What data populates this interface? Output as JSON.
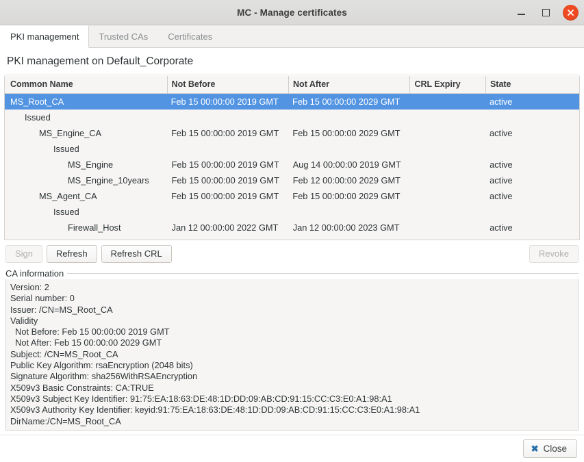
{
  "window": {
    "title": "MC - Manage certificates",
    "controls": {
      "minimize": "minimize-icon",
      "maximize": "maximize-icon",
      "close": "close-icon"
    }
  },
  "tabs": [
    {
      "label": "PKI management",
      "active": true
    },
    {
      "label": "Trusted CAs",
      "active": false
    },
    {
      "label": "Certificates",
      "active": false
    }
  ],
  "page": {
    "heading": "PKI management on Default_Corporate"
  },
  "tree": {
    "columns": [
      {
        "key": "name",
        "label": "Common Name"
      },
      {
        "key": "nb",
        "label": "Not Before"
      },
      {
        "key": "na",
        "label": "Not After"
      },
      {
        "key": "crl",
        "label": "CRL Expiry"
      },
      {
        "key": "state",
        "label": "State"
      }
    ],
    "rows": [
      {
        "indent": 1,
        "name": "MS_Root_CA",
        "nb": "Feb 15 00:00:00 2019 GMT",
        "na": "Feb 15 00:00:00 2029 GMT",
        "crl": "",
        "state": "active",
        "selected": true
      },
      {
        "indent": 2,
        "name": "Issued",
        "nb": "",
        "na": "",
        "crl": "",
        "state": "",
        "selected": false
      },
      {
        "indent": 3,
        "name": "MS_Engine_CA",
        "nb": "Feb 15 00:00:00 2019 GMT",
        "na": "Feb 15 00:00:00 2029 GMT",
        "crl": "",
        "state": "active",
        "selected": false
      },
      {
        "indent": 4,
        "name": "Issued",
        "nb": "",
        "na": "",
        "crl": "",
        "state": "",
        "selected": false
      },
      {
        "indent": 5,
        "name": "MS_Engine",
        "nb": "Feb 15 00:00:00 2019 GMT",
        "na": "Aug 14 00:00:00 2019 GMT",
        "crl": "",
        "state": "active",
        "selected": false
      },
      {
        "indent": 5,
        "name": "MS_Engine_10years",
        "nb": "Feb 15 00:00:00 2019 GMT",
        "na": "Feb 12 00:00:00 2029 GMT",
        "crl": "",
        "state": "active",
        "selected": false
      },
      {
        "indent": 3,
        "name": "MS_Agent_CA",
        "nb": "Feb 15 00:00:00 2019 GMT",
        "na": "Feb 15 00:00:00 2029 GMT",
        "crl": "",
        "state": "active",
        "selected": false
      },
      {
        "indent": 4,
        "name": "Issued",
        "nb": "",
        "na": "",
        "crl": "",
        "state": "",
        "selected": false
      },
      {
        "indent": 5,
        "name": "Firewall_Host",
        "nb": "Jan 12 00:00:00 2022 GMT",
        "na": "Jan 12 00:00:00 2023 GMT",
        "crl": "",
        "state": "active",
        "selected": false
      }
    ]
  },
  "actions": {
    "sign": {
      "label": "Sign",
      "enabled": false
    },
    "refresh": {
      "label": "Refresh",
      "enabled": true
    },
    "refresh_crl": {
      "label": "Refresh CRL",
      "enabled": true
    },
    "revoke": {
      "label": "Revoke",
      "enabled": false
    }
  },
  "ca_information": {
    "legend": "CA information",
    "text": "Version: 2\nSerial number: 0\nIssuer: /CN=MS_Root_CA\nValidity\n  Not Before: Feb 15 00:00:00 2019 GMT\n  Not After: Feb 15 00:00:00 2029 GMT\nSubject: /CN=MS_Root_CA\nPublic Key Algorithm: rsaEncryption (2048 bits)\nSignature Algorithm: sha256WithRSAEncryption\nX509v3 Basic Constraints: CA:TRUE\nX509v3 Subject Key Identifier: 91:75:EA:18:63:DE:48:1D:DD:09:AB:CD:91:15:CC:C3:E0:A1:98:A1\nX509v3 Authority Key Identifier: keyid:91:75:EA:18:63:DE:48:1D:DD:09:AB:CD:91:15:CC:C3:E0:A1:98:A1\nDirName:/CN=MS_Root_CA"
  },
  "footer": {
    "close_label": "Close",
    "close_icon": "close-x-icon"
  },
  "colors": {
    "selection": "#5294e2",
    "close_button": "#ef4b23",
    "accent_x": "#2a6fa8"
  }
}
